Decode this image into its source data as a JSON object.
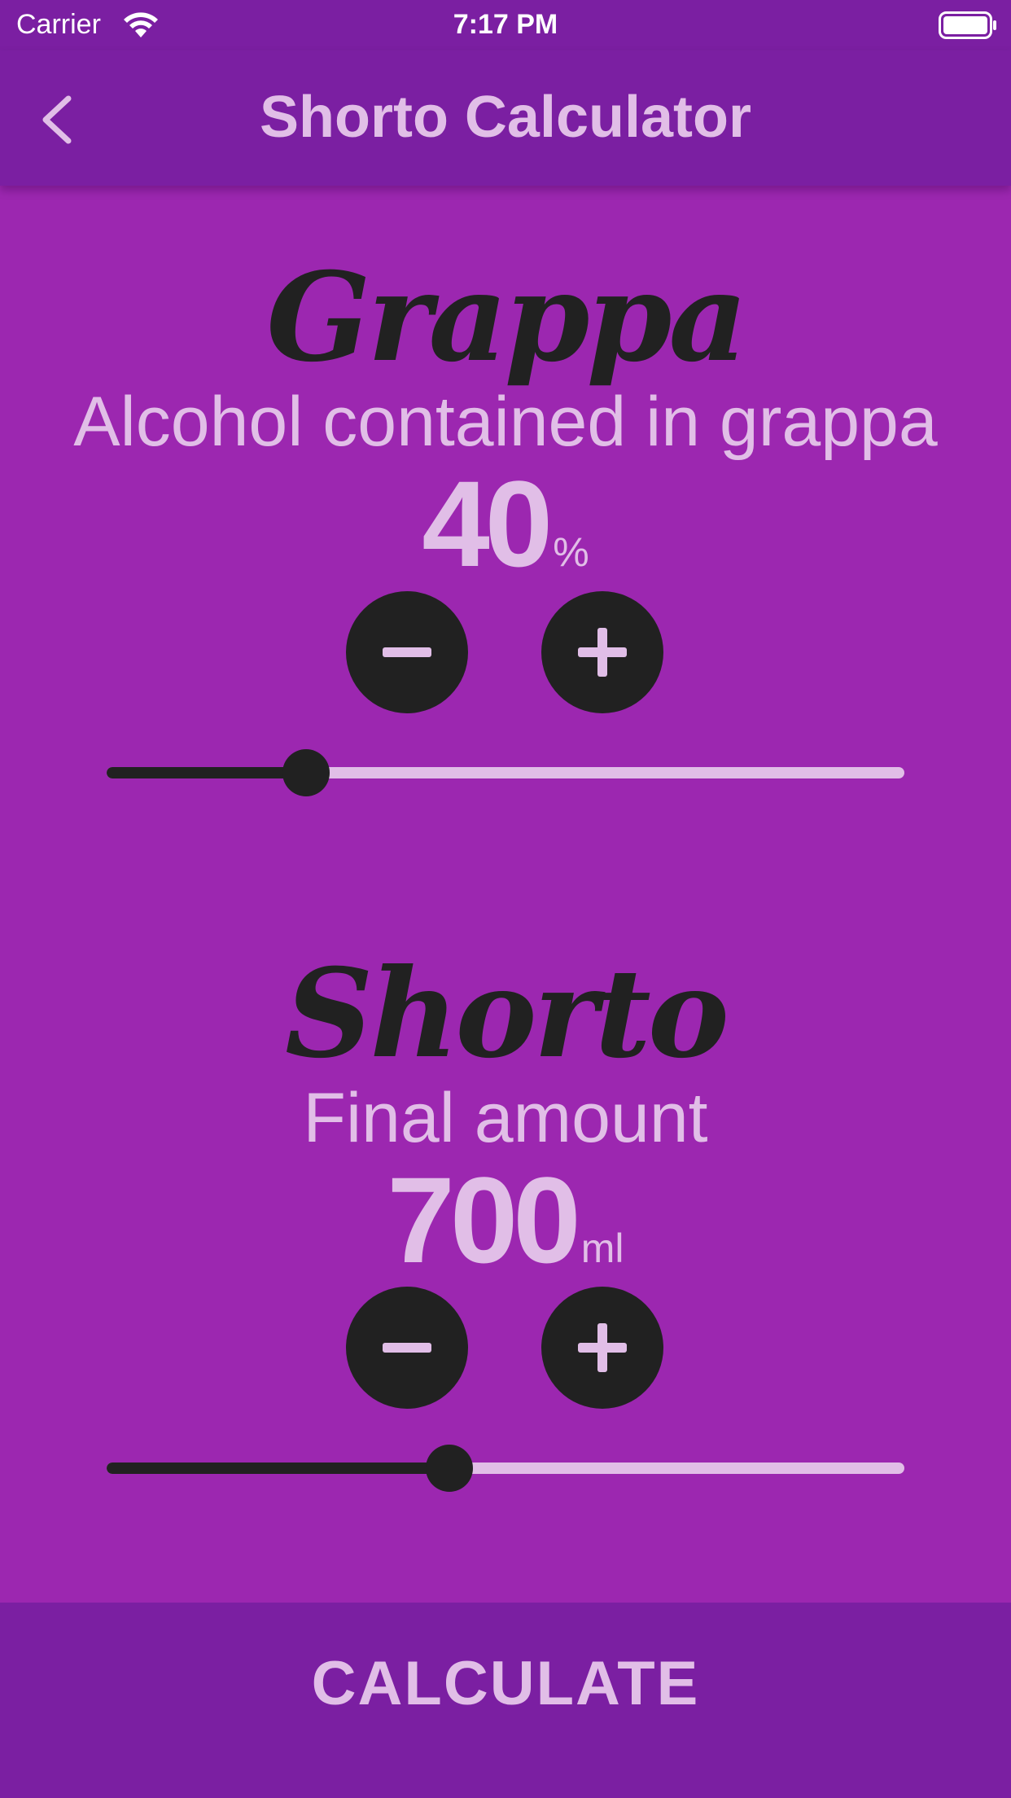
{
  "status_bar": {
    "carrier": "Carrier",
    "time": "7:17 PM",
    "wifi_icon": "wifi-icon",
    "battery_icon": "battery-icon"
  },
  "app_bar": {
    "title": "Shorto Calculator",
    "back_icon": "chevron-left-icon"
  },
  "grappa": {
    "heading": "Grappa",
    "label": "Alcohol contained in grappa",
    "value": "40",
    "unit": "%",
    "slider_fraction": 0.25,
    "decrement_icon": "minus-icon",
    "increment_icon": "plus-icon"
  },
  "shorto": {
    "heading": "Shorto",
    "label": "Final amount",
    "value": "700",
    "unit": "ml",
    "slider_fraction": 0.43,
    "decrement_icon": "minus-icon",
    "increment_icon": "plus-icon"
  },
  "calculate": {
    "label": "CALCULATE"
  },
  "colors": {
    "background": "#9c27b0",
    "bar": "#7b1fa2",
    "accent_text": "#e1bee7",
    "dark": "#212121"
  }
}
